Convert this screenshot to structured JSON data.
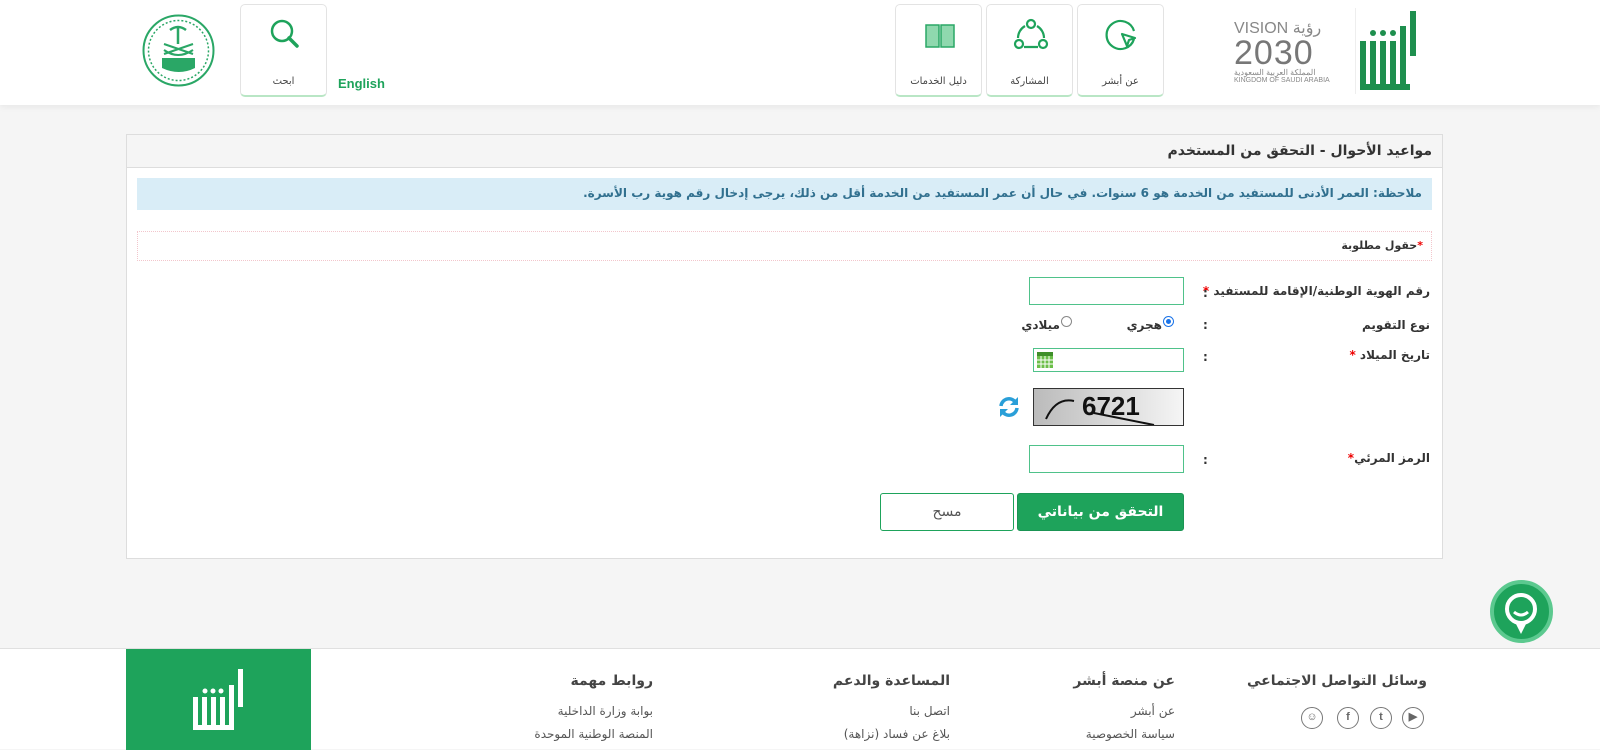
{
  "header": {
    "nav": [
      {
        "label": "عن أبشر",
        "icon": "cursor-circle-icon"
      },
      {
        "label": "المشاركة",
        "icon": "share-nodes-icon"
      },
      {
        "label": "دليل الخدمات",
        "icon": "book-icon"
      }
    ],
    "search_label": "ابحث",
    "language_link": "English",
    "logo_vision": {
      "line1": "VISION رؤية",
      "line2": "2030",
      "line3": "المملكة العربية السعودية",
      "line4": "KINGDOM OF SAUDI ARABIA"
    },
    "logo_abshir": "أبشر"
  },
  "panel": {
    "title": "مواعيد الأحوال - التحقق من المستخدم",
    "note": "ملاحظة: العمر الأدنى للمستفيد من الخدمة هو 6 سنوات. في حال أن عمر المستفيد من الخدمة أقل من ذلك، يرجى إدخال رقم هوية رب الأسرة.",
    "required_note": "حقول مطلوبة",
    "required_star": "*",
    "id_label": "رقم الهوية الوطنية/الإقامة للمستفيد",
    "id_value": "",
    "calendar_label": "نوع التقويم",
    "calendar_options": [
      "هجري",
      "ميلادي"
    ],
    "calendar_selected": "هجري",
    "dob_label": "تاريخ الميلاد",
    "dob_value": "",
    "captcha_text": "6721",
    "visual_code_label": "الرمز المرئي",
    "visual_code_value": "",
    "colon": ":",
    "verify_button": "التحقق من بياناتي",
    "clear_button": "مسح"
  },
  "footer": {
    "social": {
      "title": "وسائل التواصل الاجتماعي",
      "icons": [
        "youtube-icon",
        "twitter-icon",
        "facebook-icon",
        "snapchat-icon"
      ]
    },
    "about": {
      "title": "عن منصة أبشر",
      "links": [
        "عن أبشر",
        "سياسة الخصوصية"
      ]
    },
    "support": {
      "title": "المساعدة والدعم",
      "links": [
        "اتصل بنا",
        "بلاغ عن فساد (نزاهة)"
      ]
    },
    "links": {
      "title": "روابط مهمة",
      "links": [
        "بوابة وزارة الداخلية",
        "المنصة الوطنية الموحدة"
      ]
    },
    "logo": "أبشر"
  },
  "colors": {
    "brand": "#1ea35b",
    "note_bg": "#d9edf7",
    "note_text": "#31708f"
  }
}
